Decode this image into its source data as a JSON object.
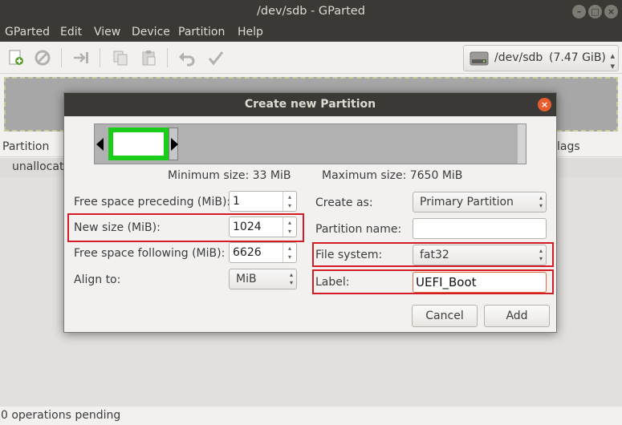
{
  "window": {
    "title": "/dev/sdb - GParted"
  },
  "menu": [
    "GParted",
    "Edit",
    "View",
    "Device",
    "Partition",
    "Help"
  ],
  "toolbar": {
    "icons": [
      "new-partition-icon",
      "delete-icon",
      "resize-move-icon",
      "copy-icon",
      "paste-icon",
      "undo-icon",
      "apply-icon"
    ],
    "device_name": "/dev/sdb",
    "device_size": "(7.47 GiB)"
  },
  "partition_list": {
    "columns": {
      "partition": "Partition",
      "flags": "lags"
    },
    "rows": [
      {
        "partition": "unallocated"
      }
    ]
  },
  "status": "0 operations pending",
  "dialog": {
    "title": "Create new Partition",
    "min_size": "Minimum size: 33 MiB",
    "max_size": "Maximum size: 7650 MiB",
    "left": {
      "free_before_label": "Free space preceding (MiB):",
      "free_before_value": "1",
      "new_size_label": "New size (MiB):",
      "new_size_value": "1024",
      "free_after_label": "Free space following (MiB):",
      "free_after_value": "6626",
      "align_label": "Align to:",
      "align_value": "MiB"
    },
    "right": {
      "create_as_label": "Create as:",
      "create_as_value": "Primary Partition",
      "partition_name_label": "Partition name:",
      "partition_name_value": "",
      "fs_label": "File system:",
      "fs_value": "fat32",
      "label_label": "Label:",
      "label_value": "UEFI_Boot"
    },
    "buttons": {
      "cancel": "Cancel",
      "add": "Add"
    }
  },
  "colors": {
    "highlight": "#d51c24",
    "selection": "#1bcc1b",
    "accent": "#e85d2d"
  }
}
